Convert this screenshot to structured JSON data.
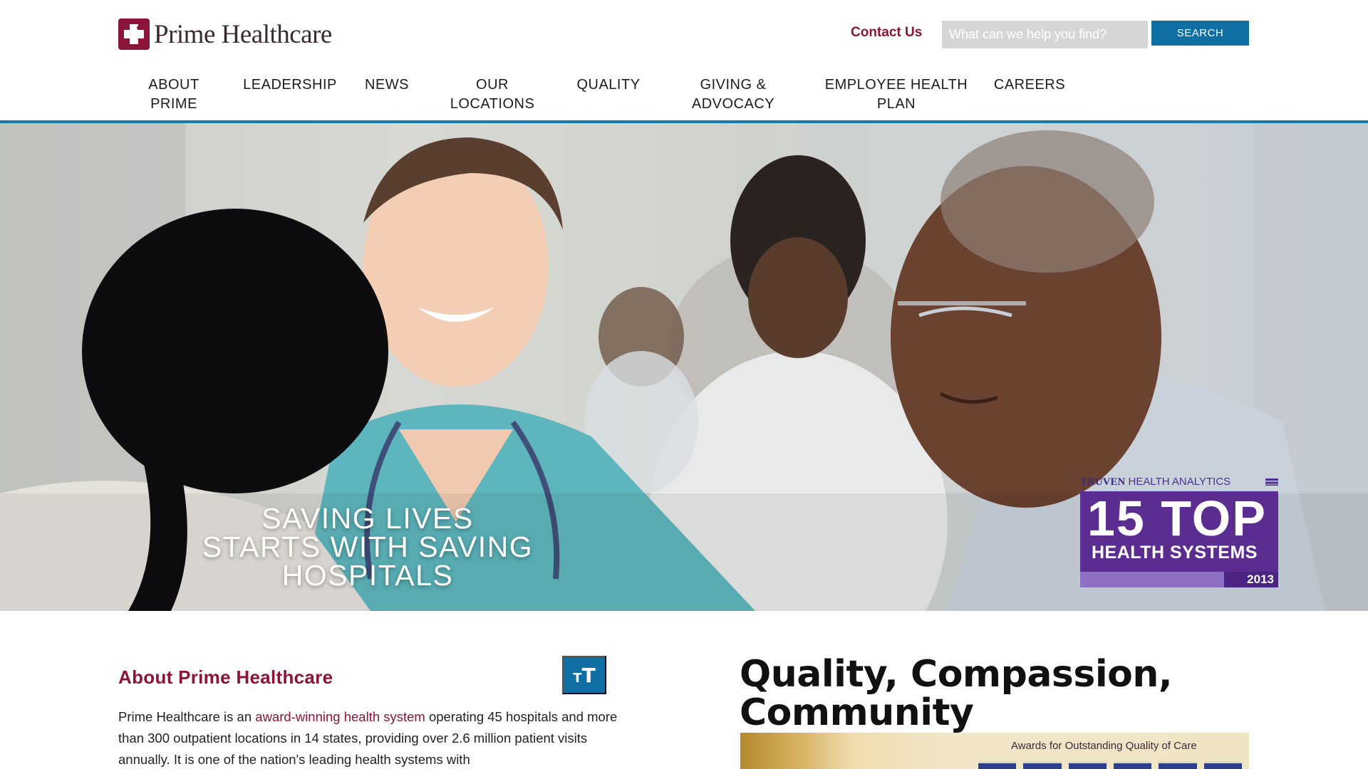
{
  "brand": {
    "name": "Prime Healthcare"
  },
  "header": {
    "contact_label": "Contact Us",
    "search_placeholder": "What can we help you find?",
    "search_button": "SEARCH"
  },
  "nav": {
    "items": [
      {
        "line1": "ABOUT",
        "line2": "PRIME"
      },
      {
        "line1": "LEADERSHIP",
        "line2": ""
      },
      {
        "line1": "NEWS",
        "line2": ""
      },
      {
        "line1": "OUR",
        "line2": "LOCATIONS"
      },
      {
        "line1": "QUALITY",
        "line2": ""
      },
      {
        "line1": "GIVING &",
        "line2": "ADVOCACY"
      },
      {
        "line1": "EMPLOYEE HEALTH",
        "line2": "PLAN"
      },
      {
        "line1": "CAREERS",
        "line2": ""
      }
    ]
  },
  "hero": {
    "line1": "SAVING LIVES",
    "line2": "STARTS WITH SAVING HOSPITALS",
    "award": {
      "brand_bold": "TRUVEN",
      "brand_rest": "HEALTH ANALYTICS",
      "big": "15 TOP",
      "sub": "HEALTH SYSTEMS",
      "year": "2013"
    }
  },
  "about": {
    "title": "About Prime Healthcare",
    "text_size_icon": "text-size-icon",
    "text_before_link": "Prime Healthcare is an ",
    "link_text": "award-winning health system",
    "text_after_link": " operating 45 hospitals and more than 300 outpatient locations in 14 states, providing over 2.6 million patient visits annually. It is one of the nation's leading health systems with"
  },
  "quality": {
    "title": "Quality, Compassion, Community",
    "banner_text": "Awards for Outstanding Quality of Care"
  },
  "colors": {
    "brand": "#8a1538",
    "accent_blue": "#0f6fa3",
    "nav_bar": "#1779ac",
    "award_purple": "#5b2d91"
  }
}
